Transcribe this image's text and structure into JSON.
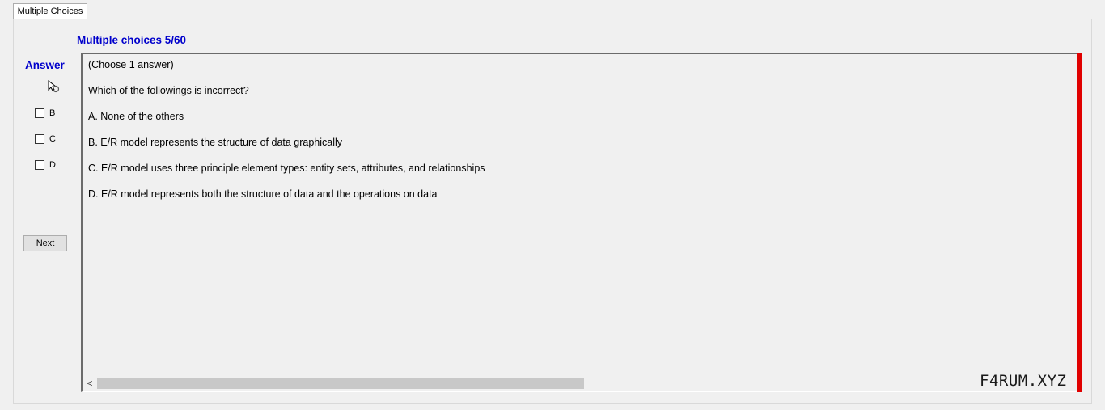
{
  "tabs": [
    {
      "label": "Multiple Choices"
    }
  ],
  "question": {
    "counter": "Multiple choices 5/60",
    "instruction": "(Choose 1 answer)",
    "prompt": "Which of the followings is incorrect?",
    "options": [
      "A.  None of the others",
      "B.  E/R model represents the structure of data graphically",
      "C.  E/R model uses three principle element types: entity sets, attributes, and relationships",
      "D.  E/R model represents both the structure of data and the operations on data"
    ]
  },
  "answer": {
    "label": "Answer",
    "choices": [
      "B",
      "C",
      "D"
    ],
    "cursor_icon": "cursor-busy-icon"
  },
  "buttons": {
    "next": "Next"
  },
  "scrollbar": {
    "left_arrow": "<"
  },
  "watermark": "F4RUM.XYZ",
  "colors": {
    "accent": "#0000cc",
    "marker": "#e00000"
  }
}
